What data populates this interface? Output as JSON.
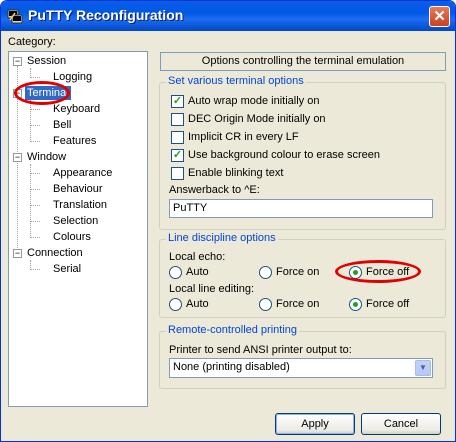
{
  "window": {
    "title": "PuTTY Reconfiguration",
    "close_glyph": "✕"
  },
  "category": {
    "label": "Category:",
    "tree": [
      "Session",
      "Logging",
      "Terminal",
      "Keyboard",
      "Bell",
      "Features",
      "Window",
      "Appearance",
      "Behaviour",
      "Translation",
      "Selection",
      "Colours",
      "Connection",
      "Serial"
    ]
  },
  "panel": {
    "header": "Options controlling the terminal emulation",
    "terminal_options": {
      "title": "Set various terminal options",
      "checkboxes": [
        {
          "label": "Auto wrap mode initially on",
          "checked": true
        },
        {
          "label": "DEC Origin Mode initially on",
          "checked": false
        },
        {
          "label": "Implicit CR in every LF",
          "checked": false
        },
        {
          "label": "Use background colour to erase screen",
          "checked": true
        },
        {
          "label": "Enable blinking text",
          "checked": false
        }
      ],
      "answerback_label": "Answerback to ^E:",
      "answerback_value": "PuTTY"
    },
    "line_discipline": {
      "title": "Line discipline options",
      "local_echo_label": "Local echo:",
      "local_echo_options": [
        "Auto",
        "Force on",
        "Force off"
      ],
      "local_echo_selected": "Force off",
      "local_line_editing_label": "Local line editing:",
      "local_line_editing_options": [
        "Auto",
        "Force on",
        "Force off"
      ],
      "local_line_editing_selected": "Force off"
    },
    "printing": {
      "title": "Remote-controlled printing",
      "printer_label": "Printer to send ANSI printer output to:",
      "printer_value": "None (printing disabled)"
    }
  },
  "buttons": {
    "apply": "Apply",
    "cancel": "Cancel"
  },
  "annotations": {
    "color": "#e00000",
    "highlighted": [
      "Terminal",
      "Force off"
    ]
  }
}
